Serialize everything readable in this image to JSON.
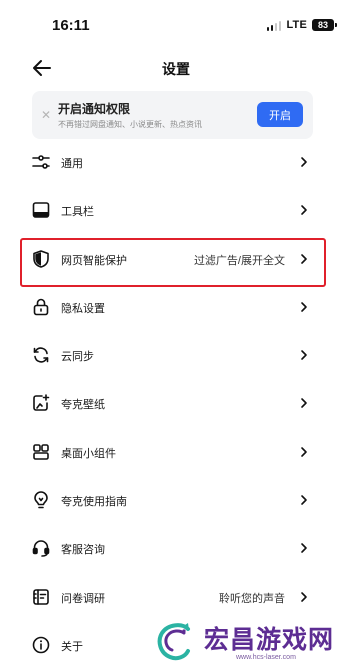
{
  "status_bar": {
    "time": "16:11",
    "network": "LTE",
    "battery": "83"
  },
  "header": {
    "title": "设置",
    "back_icon": "arrow-left-icon"
  },
  "notice": {
    "close_icon": "close-icon",
    "title": "开启通知权限",
    "subtitle": "不再错过网盘通知、小说更新、热点资讯",
    "button": "开启",
    "accent": "#2f6bf3"
  },
  "menu": {
    "items": [
      {
        "icon": "sliders-icon",
        "label": "通用",
        "value": ""
      },
      {
        "icon": "toolbar-icon",
        "label": "工具栏",
        "value": ""
      },
      {
        "icon": "shield-icon",
        "label": "网页智能保护",
        "value": "过滤广告/展开全文",
        "highlighted": true
      },
      {
        "icon": "lock-icon",
        "label": "隐私设置",
        "value": ""
      },
      {
        "icon": "sync-icon",
        "label": "云同步",
        "value": ""
      },
      {
        "icon": "wallpaper-icon",
        "label": "夸克壁纸",
        "value": ""
      },
      {
        "icon": "widgets-icon",
        "label": "桌面小组件",
        "value": ""
      },
      {
        "icon": "lightbulb-icon",
        "label": "夸克使用指南",
        "value": ""
      },
      {
        "icon": "headset-icon",
        "label": "客服咨询",
        "value": ""
      },
      {
        "icon": "survey-icon",
        "label": "问卷调研",
        "value": "聆听您的声音"
      },
      {
        "icon": "info-icon",
        "label": "关于",
        "value": ""
      }
    ],
    "highlight_color": "#e0202b"
  },
  "watermark": {
    "text": "宏昌游戏网",
    "url": "www.hcs-laser.com",
    "color": "#5d2d93"
  }
}
